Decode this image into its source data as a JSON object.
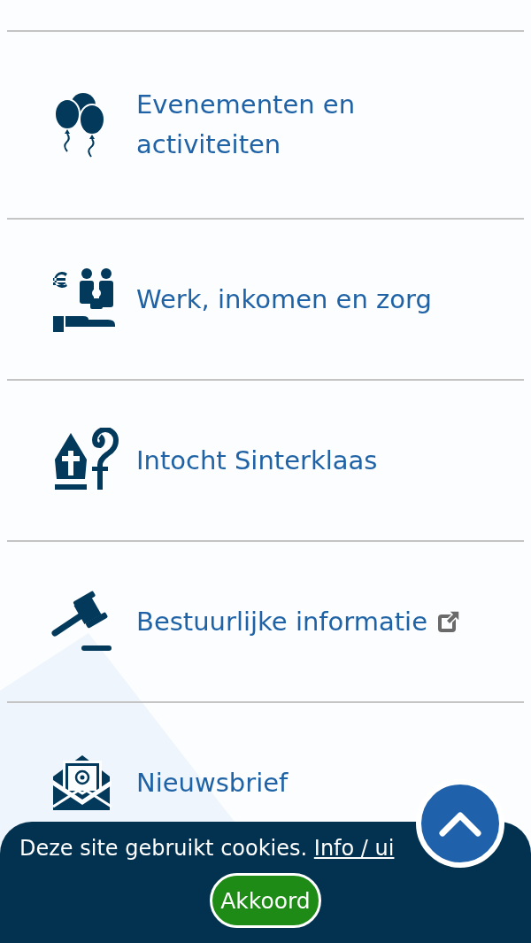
{
  "menu_items": [
    {
      "label": "Evenementen en activiteiten",
      "external": false
    },
    {
      "label": "Werk, inkomen en zorg",
      "external": false
    },
    {
      "label": "Intocht Sinterklaas",
      "external": false
    },
    {
      "label": "Bestuurlijke informatie",
      "external": true
    },
    {
      "label": "Nieuwsbrief",
      "external": false
    }
  ],
  "cookie_bar": {
    "message": "Deze site gebruikt cookies.",
    "link": "Info / ui",
    "button": "Akkoord"
  }
}
